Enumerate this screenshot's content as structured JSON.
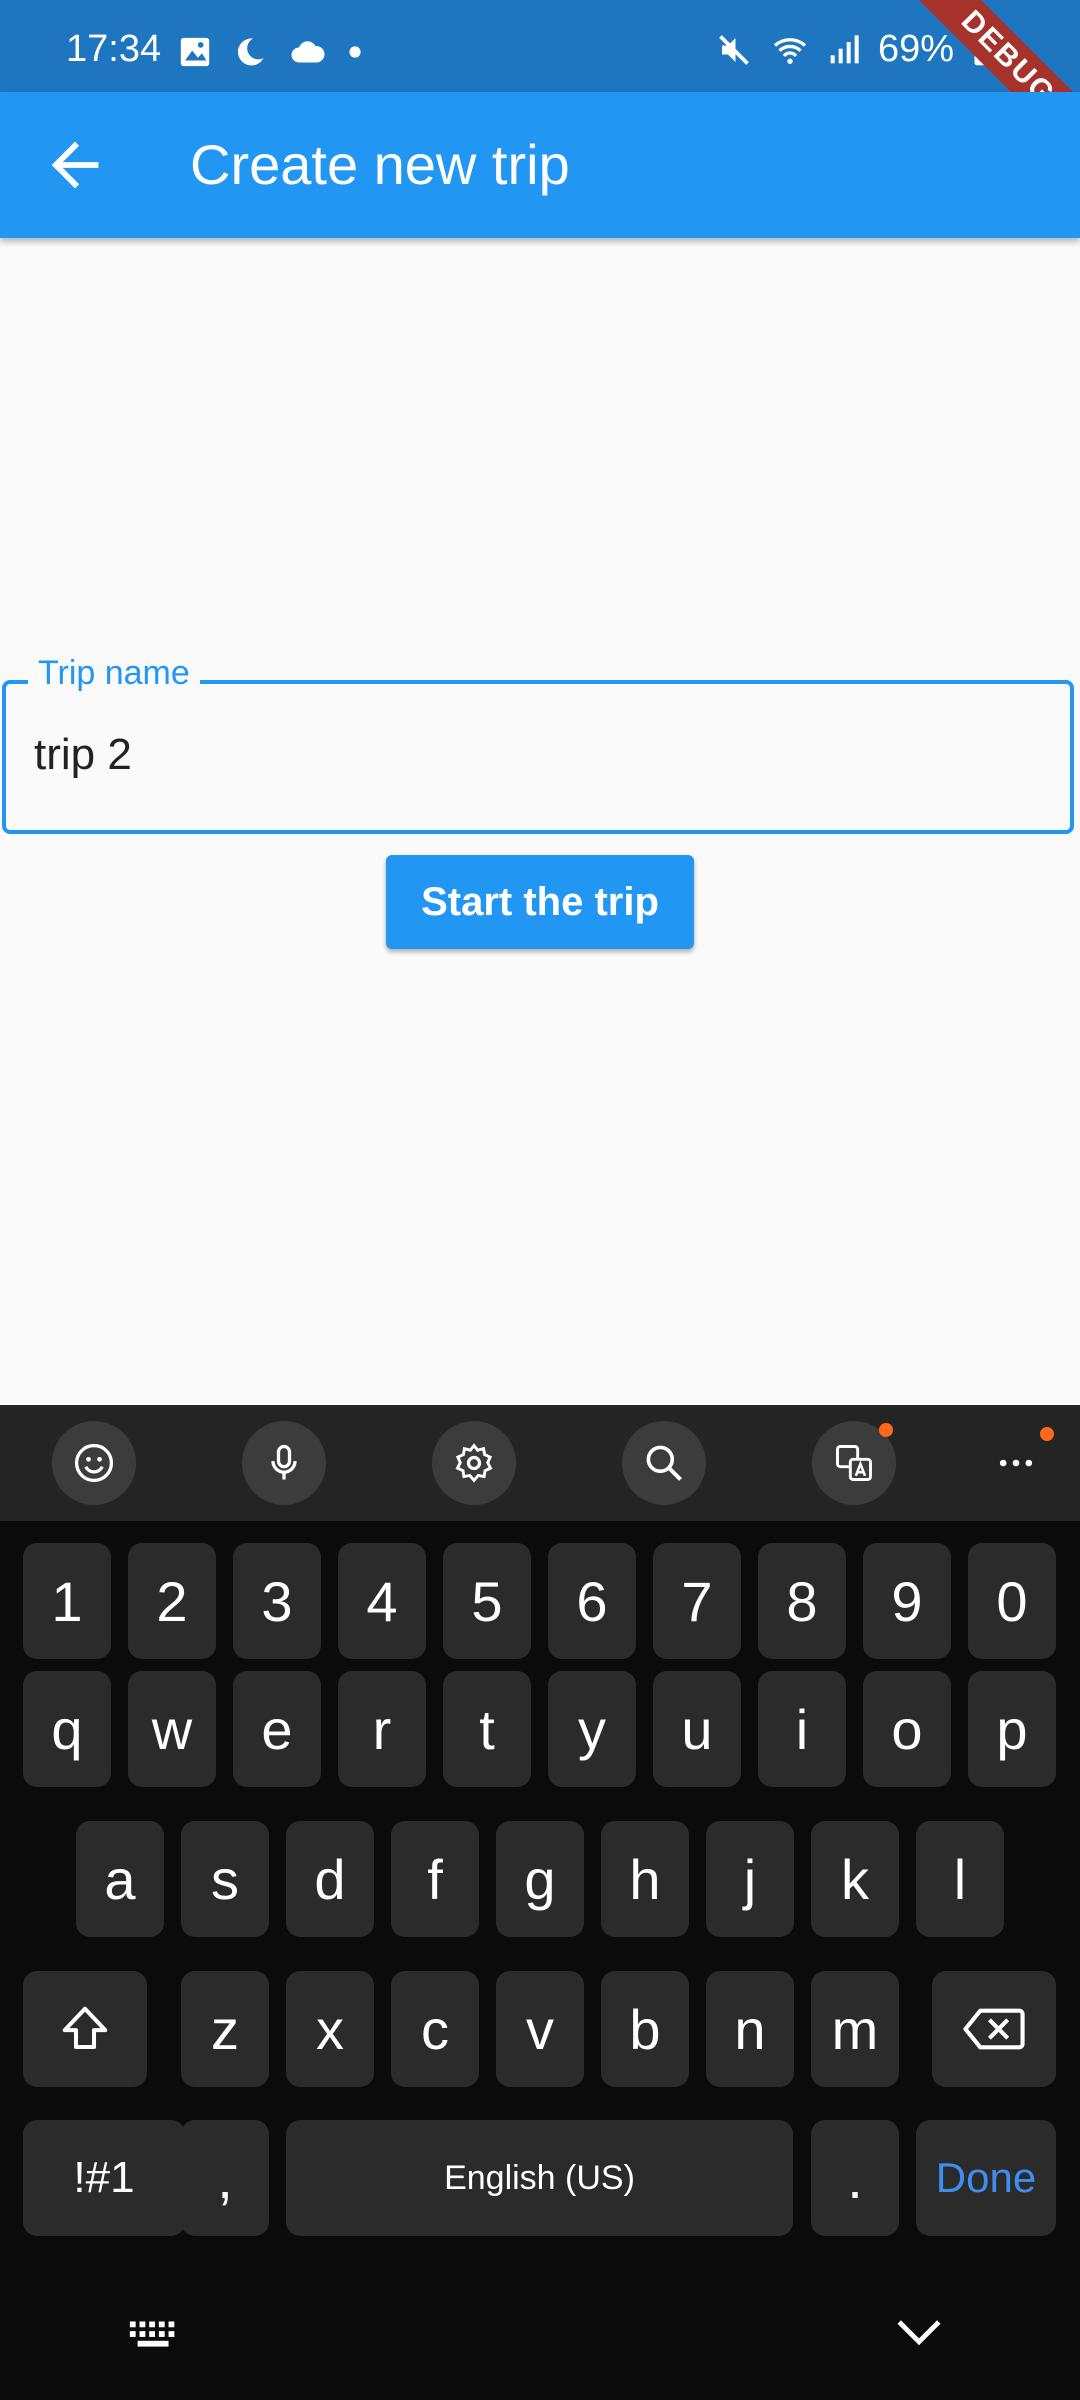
{
  "status_bar": {
    "time": "17:34",
    "battery": "69%",
    "debug_label": "DEBUG",
    "icons": [
      "image-icon",
      "moon-icon",
      "cloud-icon",
      "dot-icon",
      "mute-icon",
      "wifi-icon",
      "signal-icon",
      "battery-icon"
    ]
  },
  "app_bar": {
    "title": "Create new trip",
    "back_icon": "arrow-back-icon"
  },
  "form": {
    "field_label": "Trip name",
    "field_value": "trip 2",
    "submit_label": "Start the trip"
  },
  "colors": {
    "primary": "#2196f3",
    "status_bar": "#1f76c0",
    "keyboard_bg": "#0b0b0b",
    "key_bg": "#2b2b2b",
    "done_text": "#3e8ef0",
    "badge": "#ff6a1a"
  },
  "keyboard": {
    "toolbar_icons": [
      "emoji-icon",
      "mic-icon",
      "settings-icon",
      "search-icon",
      "translate-icon",
      "more-icon"
    ],
    "row_numbers": [
      "1",
      "2",
      "3",
      "4",
      "5",
      "6",
      "7",
      "8",
      "9",
      "0"
    ],
    "row_top": [
      "q",
      "w",
      "e",
      "r",
      "t",
      "y",
      "u",
      "i",
      "o",
      "p"
    ],
    "row_middle": [
      "a",
      "s",
      "d",
      "f",
      "g",
      "h",
      "j",
      "k",
      "l"
    ],
    "row_bottom": [
      "z",
      "x",
      "c",
      "v",
      "b",
      "n",
      "m"
    ],
    "symbols_key": "!#1",
    "comma_key": ",",
    "space_key": "English (US)",
    "period_key": ".",
    "done_key": "Done",
    "shift_icon": "shift-icon",
    "backspace_icon": "backspace-icon",
    "nav_icons": [
      "keyboard-icon",
      "chevron-down-icon"
    ]
  }
}
